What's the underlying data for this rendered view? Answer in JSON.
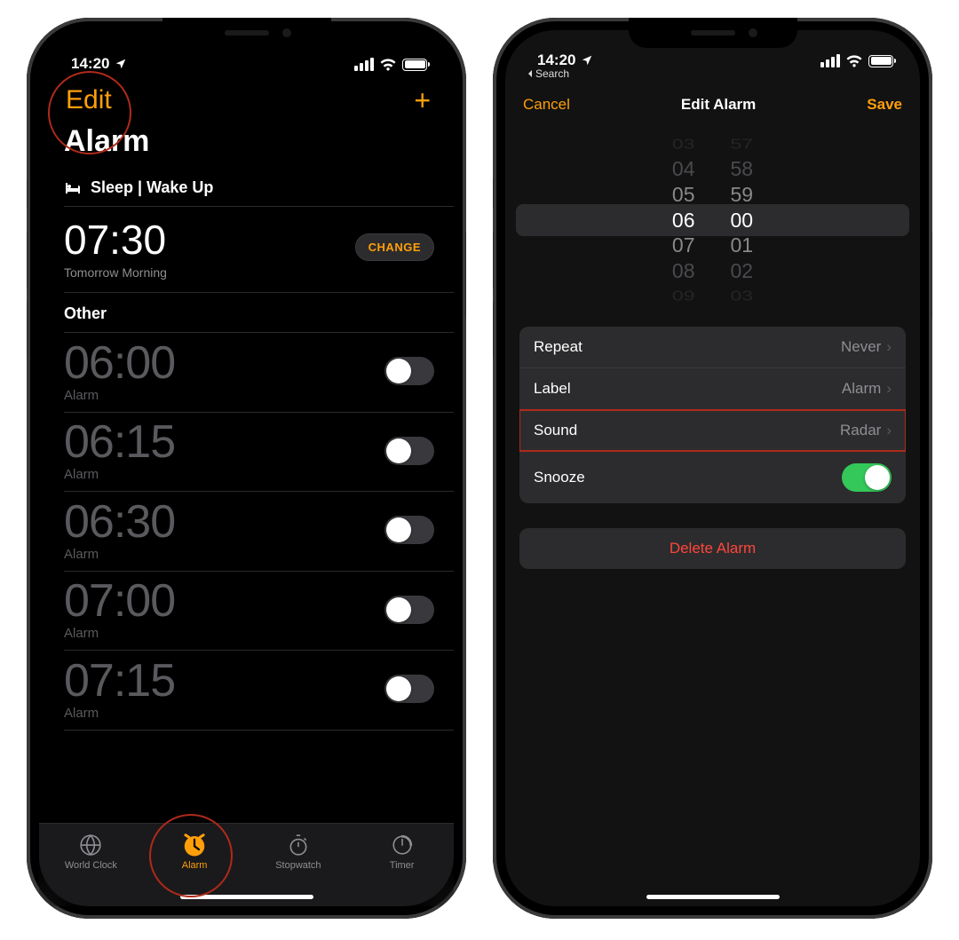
{
  "screen1": {
    "status": {
      "time": "14:20",
      "back_label": ""
    },
    "nav": {
      "edit": "Edit",
      "add": "+"
    },
    "title": "Alarm",
    "sleep": {
      "header": "Sleep | Wake Up",
      "time": "07:30",
      "sub": "Tomorrow Morning",
      "change": "CHANGE"
    },
    "other_header": "Other",
    "alarms": [
      {
        "time": "06:00",
        "label": "Alarm",
        "on": false
      },
      {
        "time": "06:15",
        "label": "Alarm",
        "on": false
      },
      {
        "time": "06:30",
        "label": "Alarm",
        "on": false
      },
      {
        "time": "07:00",
        "label": "Alarm",
        "on": false
      },
      {
        "time": "07:15",
        "label": "Alarm",
        "on": false
      }
    ],
    "tabs": {
      "world": "World Clock",
      "alarm": "Alarm",
      "stopwatch": "Stopwatch",
      "timer": "Timer"
    }
  },
  "screen2": {
    "status": {
      "time": "14:20",
      "back_label": "Search"
    },
    "nav": {
      "cancel": "Cancel",
      "title": "Edit Alarm",
      "save": "Save"
    },
    "picker": {
      "hours": [
        "03",
        "04",
        "05",
        "06",
        "07",
        "08",
        "09"
      ],
      "mins": [
        "57",
        "58",
        "59",
        "00",
        "01",
        "02",
        "03"
      ],
      "selected_hour": "06",
      "selected_min": "00"
    },
    "rows": {
      "repeat": {
        "label": "Repeat",
        "value": "Never"
      },
      "label": {
        "label": "Label",
        "value": "Alarm"
      },
      "sound": {
        "label": "Sound",
        "value": "Radar"
      },
      "snooze": {
        "label": "Snooze",
        "on": true
      }
    },
    "delete": "Delete Alarm"
  }
}
